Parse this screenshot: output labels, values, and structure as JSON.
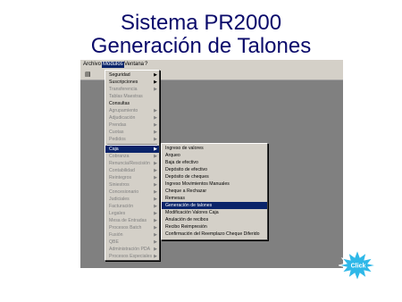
{
  "slide": {
    "title_line1": "Sistema PR2000",
    "title_line2": "Generación de Talones"
  },
  "menubar": [
    "Archivo",
    "Módulos",
    "Ventana",
    "?"
  ],
  "modules_menu": [
    {
      "label": "Seguridad",
      "enabled": true,
      "submenu": true
    },
    {
      "label": "Suscripciones",
      "enabled": true,
      "submenu": true
    },
    {
      "label": "Transferencia",
      "enabled": false,
      "submenu": true
    },
    {
      "label": "Tablas Maestras",
      "enabled": false,
      "submenu": false
    },
    {
      "label": "Consultas",
      "enabled": true,
      "submenu": false
    },
    {
      "label": "Agrupamiento",
      "enabled": false,
      "submenu": true
    },
    {
      "label": "Adjudicación",
      "enabled": false,
      "submenu": true
    },
    {
      "label": "Prendas",
      "enabled": false,
      "submenu": true
    },
    {
      "label": "Cuotas",
      "enabled": false,
      "submenu": true
    },
    {
      "label": "Pedidos",
      "enabled": false,
      "submenu": true
    },
    {
      "label": "Caja",
      "enabled": true,
      "submenu": true,
      "selected": true
    },
    {
      "label": "Cobranza",
      "enabled": false,
      "submenu": true
    },
    {
      "label": "Renuncia/Rescisión",
      "enabled": false,
      "submenu": true
    },
    {
      "label": "Contabilidad",
      "enabled": false,
      "submenu": true
    },
    {
      "label": "Reintegros",
      "enabled": false,
      "submenu": true
    },
    {
      "label": "Siniestros",
      "enabled": false,
      "submenu": true
    },
    {
      "label": "Concesionario",
      "enabled": false,
      "submenu": true
    },
    {
      "label": "Judiciales",
      "enabled": false,
      "submenu": true
    },
    {
      "label": "Facturación",
      "enabled": false,
      "submenu": true
    },
    {
      "label": "Legales",
      "enabled": false,
      "submenu": true
    },
    {
      "label": "Mesa de Entradas",
      "enabled": false,
      "submenu": true
    },
    {
      "label": "Procesos Batch",
      "enabled": false,
      "submenu": true
    },
    {
      "label": "Fusión",
      "enabled": false,
      "submenu": true
    },
    {
      "label": "QBE",
      "enabled": false,
      "submenu": true
    },
    {
      "label": "Administración PDA",
      "enabled": false,
      "submenu": true
    },
    {
      "label": "Procesos Especiales",
      "enabled": false,
      "submenu": true
    }
  ],
  "caja_menu": [
    {
      "label": "Ingreso de valores"
    },
    {
      "label": "Arqueo"
    },
    {
      "label": "Baja de efectivo"
    },
    {
      "label": "Depósito de efectivo"
    },
    {
      "label": "Depósito de cheques"
    },
    {
      "label": "Ingreso Movimientos Manuales"
    },
    {
      "label": "Cheque a Rechazar"
    },
    {
      "label": "Remesas"
    },
    {
      "label": "Generación de talones",
      "selected": true
    },
    {
      "label": "Modificación Valores Caja"
    },
    {
      "label": "Anulación de recibos"
    },
    {
      "label": "Recibo Reimpresión"
    },
    {
      "label": "Confirmación del Reemplazo Cheque Diferido"
    }
  ],
  "callout": {
    "label": "Click"
  },
  "colors": {
    "title": "#0a0a6a",
    "highlight": "#0a246a",
    "callout": "#2fb8e8"
  }
}
